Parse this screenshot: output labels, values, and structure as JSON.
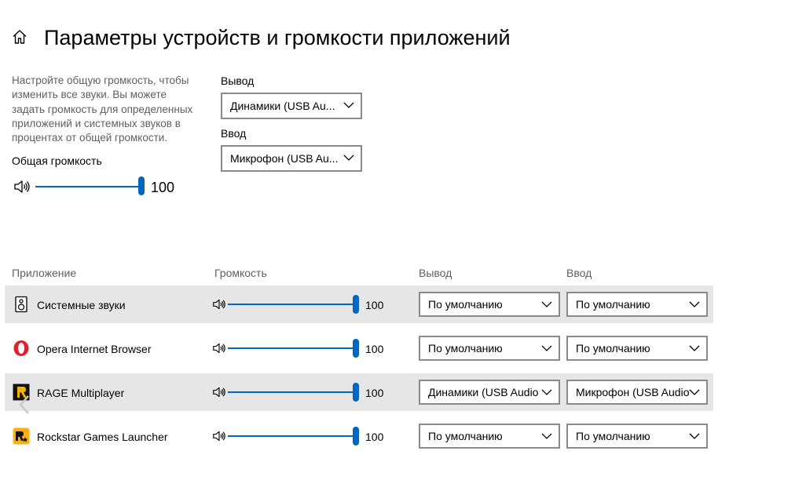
{
  "header": {
    "title": "Параметры устройств и громкости приложений"
  },
  "master": {
    "description": "Настройте общую громкость, чтобы изменить все звуки. Вы можете задать громкость для определенных приложений и системных звуков в процентах от общей громкости.",
    "label": "Общая громкость",
    "value": "100",
    "level": 1.0
  },
  "devices": {
    "output_label": "Вывод",
    "output_value": "Динамики (USB Au...",
    "input_label": "Ввод",
    "input_value": "Микрофон (USB Au..."
  },
  "table": {
    "headers": {
      "app": "Приложение",
      "volume": "Громкость",
      "output": "Вывод",
      "input": "Ввод"
    },
    "rows": [
      {
        "name": "Системные звуки",
        "icon": "system-sounds-icon",
        "volume": "100",
        "level": 1.0,
        "output": "По умолчанию",
        "input": "По умолчанию",
        "shaded": true
      },
      {
        "name": "Opera Internet Browser",
        "icon": "opera-icon",
        "volume": "100",
        "level": 1.0,
        "output": "По умолчанию",
        "input": "По умолчанию",
        "shaded": false
      },
      {
        "name": "RAGE Multiplayer",
        "icon": "rage-mp-icon",
        "volume": "100",
        "level": 1.0,
        "output": "Динамики (USB Audio",
        "input": "Микрофон (USB Audio",
        "shaded": true
      },
      {
        "name": "Rockstar Games Launcher",
        "icon": "rockstar-icon",
        "volume": "100",
        "level": 1.0,
        "output": "По умолчанию",
        "input": "По умолчанию",
        "shaded": false
      }
    ]
  },
  "colors": {
    "accent": "#0067c0",
    "row_shade": "#e6e6e6",
    "opera": "#e0202e",
    "rockstar": "#fcaf17"
  }
}
